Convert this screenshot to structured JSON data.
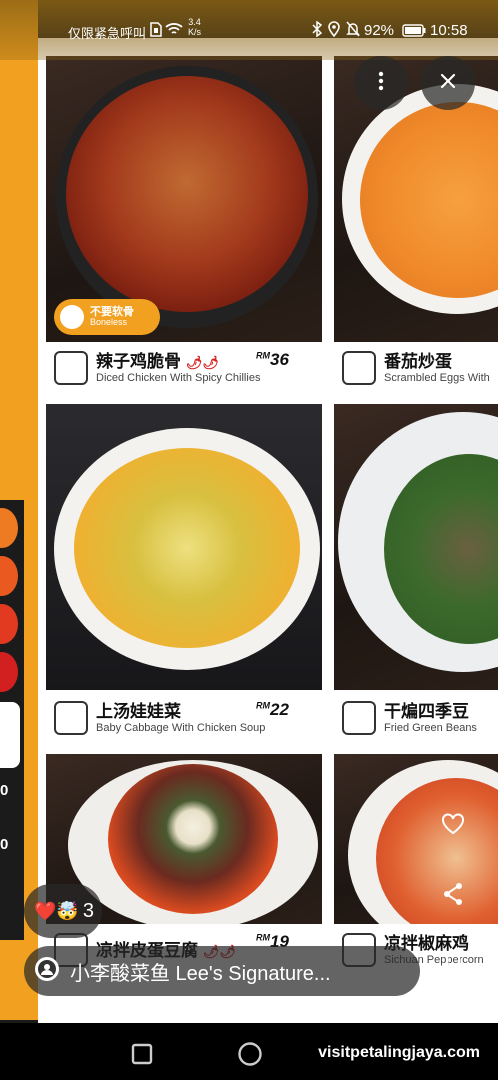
{
  "status_bar": {
    "carrier": "仅限紧急呼叫",
    "speed_value": "3.4",
    "speed_unit": "K/s",
    "battery": "92%",
    "time": "10:58"
  },
  "menu": {
    "badge": {
      "zh": "不要软骨",
      "en": "Boneless"
    },
    "items": [
      {
        "zh": "辣子鸡脆骨",
        "en": "Diced Chicken With Spicy Chillies",
        "price_prefix": "RM",
        "price": "36",
        "chili": "🌶🌶"
      },
      {
        "zh": "番茄炒蛋",
        "en": "Scrambled Eggs With",
        "price_prefix": "",
        "price": "",
        "chili": ""
      },
      {
        "zh": "上汤娃娃菜",
        "en": "Baby Cabbage With Chicken Soup",
        "price_prefix": "RM",
        "price": "22",
        "chili": ""
      },
      {
        "zh": "干煸四季豆",
        "en": "Fried Green Beans",
        "price_prefix": "",
        "price": "",
        "chili": ""
      },
      {
        "zh": "凉拌皮蛋豆腐",
        "en": "",
        "price_prefix": "RM",
        "price": "19",
        "chili": "🌶🌶"
      },
      {
        "zh": "凉拌椒麻鸡",
        "en": "Sichuan Peppercorn",
        "price_prefix": "",
        "price": "",
        "chili": ""
      }
    ],
    "side_numbers": [
      "0",
      "0"
    ]
  },
  "overlay": {
    "reaction_emoji": "❤️🤯",
    "reaction_count": "3",
    "caption": "小李酸菜鱼 Lee's Signature..."
  },
  "watermark": "visitpetalingjaya.com",
  "icons": {
    "more": "more-vertical-icon",
    "close": "close-icon",
    "like": "heart-icon",
    "share": "share-icon",
    "save": "bookmark-icon"
  },
  "colors": {
    "menu_orange": "#f2a020",
    "chili_red": "#d82020"
  }
}
